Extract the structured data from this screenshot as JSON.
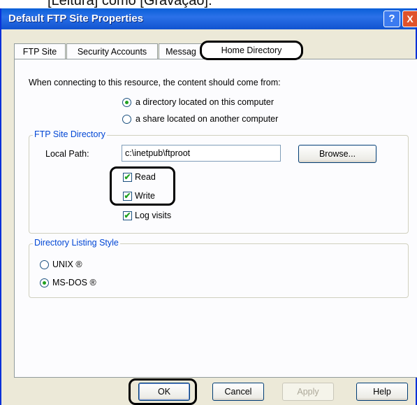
{
  "caption": "[Leitura] como [Gravação].",
  "window": {
    "title": "Default FTP Site Properties",
    "help_glyph": "?",
    "close_glyph": "X"
  },
  "tabs": [
    {
      "label": "FTP Site"
    },
    {
      "label": "Security Accounts"
    },
    {
      "label": "Messag"
    },
    {
      "label": "Home Directory"
    }
  ],
  "content": {
    "prompt": "When connecting to this resource, the content should come from:",
    "source_options": [
      {
        "label": "a directory located on this computer",
        "selected": true
      },
      {
        "label": "a share located on another computer",
        "selected": false
      }
    ]
  },
  "ftp_dir": {
    "group_label": "FTP Site Directory",
    "local_path_label": "Local Path:",
    "local_path_value": "c:\\inetpub\\ftproot",
    "browse_label": "Browse...",
    "permissions": [
      {
        "label": "Read",
        "checked": true
      },
      {
        "label": "Write",
        "checked": true
      },
      {
        "label": "Log visits",
        "checked": true
      }
    ]
  },
  "listing": {
    "group_label": "Directory Listing Style",
    "options": [
      {
        "label": "UNIX ®",
        "selected": false
      },
      {
        "label": "MS-DOS ®",
        "selected": true
      }
    ]
  },
  "buttons": {
    "ok": "OK",
    "cancel": "Cancel",
    "apply": "Apply",
    "help": "Help"
  },
  "check_glyph": "✔"
}
